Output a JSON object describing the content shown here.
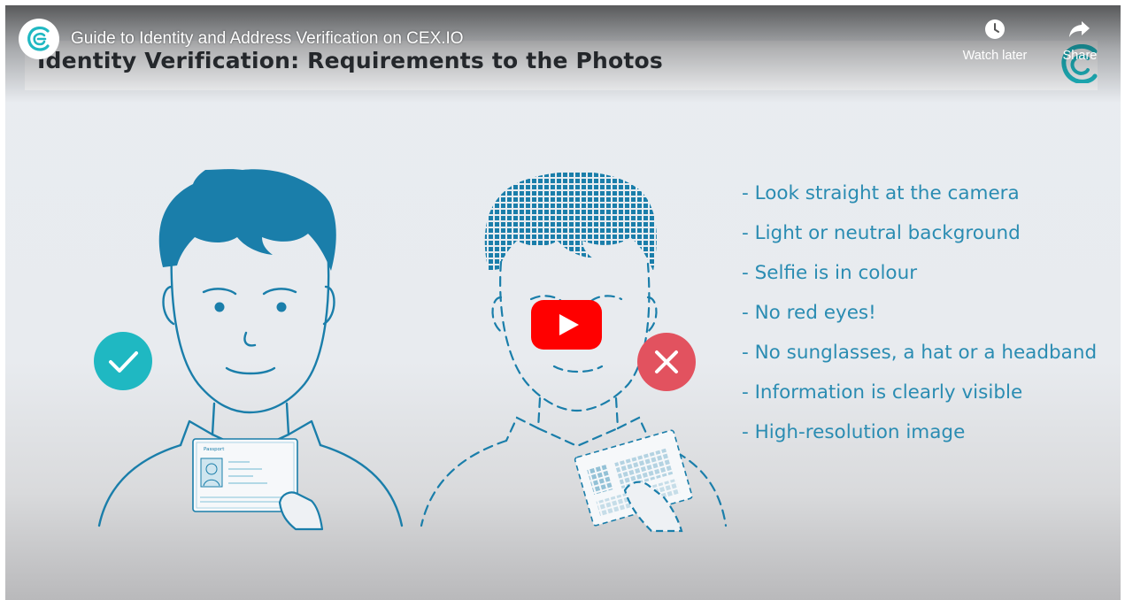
{
  "player": {
    "video_title": "Guide to Identity and Address Verification on CEX.IO",
    "watch_later_label": "Watch later",
    "share_label": "Share",
    "channel_logo_icon": "cex-logo-icon",
    "play_icon": "youtube-play-icon"
  },
  "slide": {
    "title": "Identity Verification: Requirements to the Photos",
    "requirements": [
      "- Look straight at the camera",
      "- Light or neutral background",
      "- Selfie is in colour",
      "- No red eyes!",
      "- No sunglasses, a hat or a headband",
      "- Information is clearly visible",
      "- High-resolution image"
    ],
    "good_example_badge": "checkmark-icon",
    "bad_example_badge": "cross-icon",
    "passport_label": "Passport"
  },
  "colors": {
    "accent_teal": "#1fb8c2",
    "reject_red": "#e2525f",
    "text_blue": "#2a8cb2",
    "hair_blue": "#1a7eaa",
    "youtube_red": "#ff0000"
  }
}
